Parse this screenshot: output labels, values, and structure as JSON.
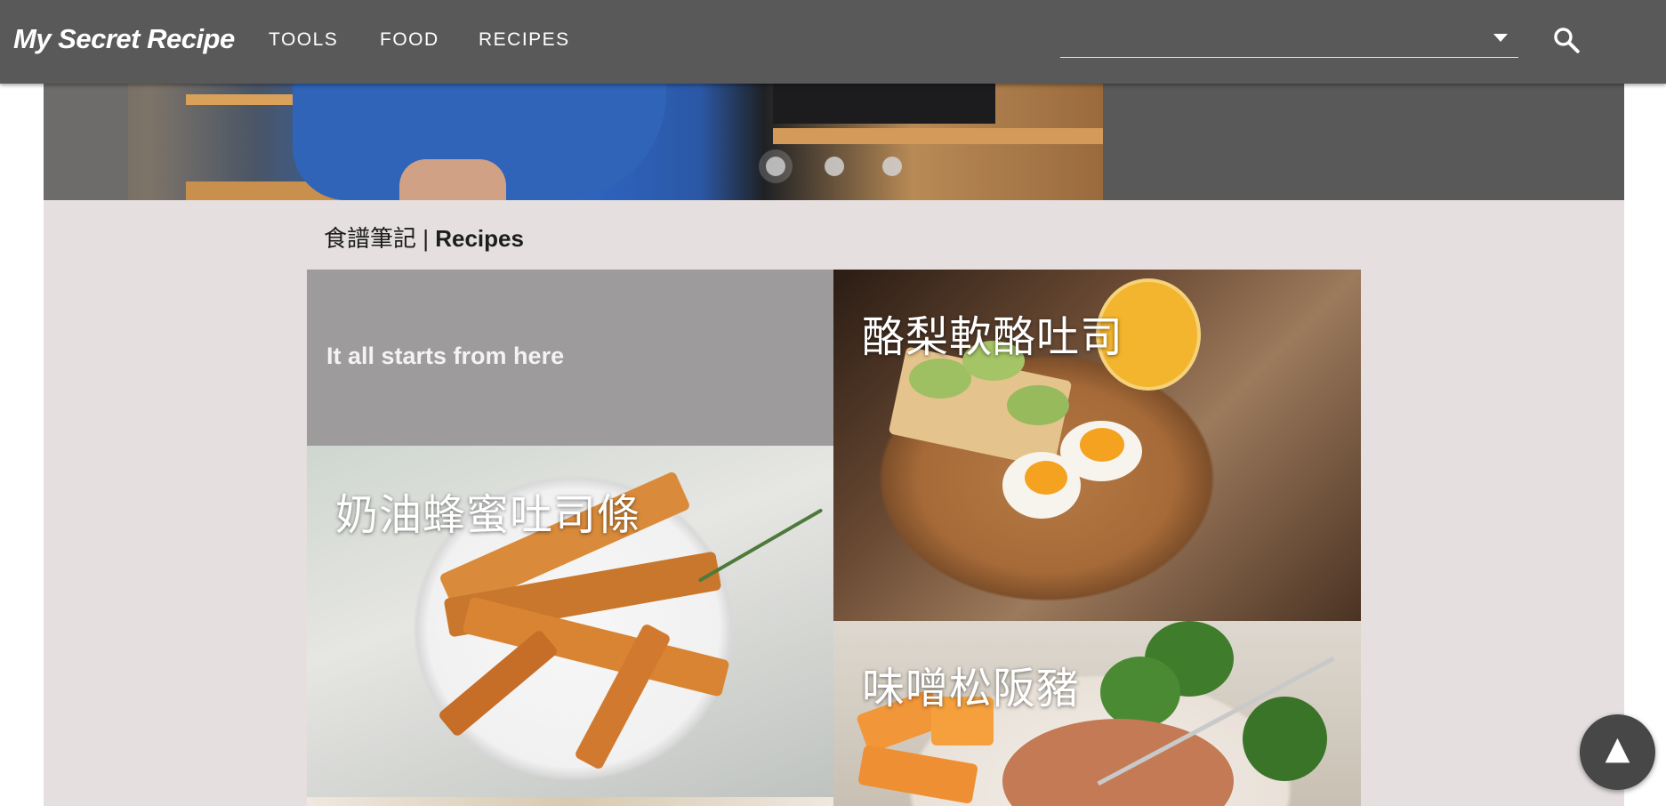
{
  "header": {
    "brand": "My Secret Recipe",
    "nav": [
      {
        "label": "TOOLS"
      },
      {
        "label": "FOOD"
      },
      {
        "label": "RECIPES"
      }
    ],
    "search": {
      "value": "",
      "placeholder": "",
      "icon": "search-icon",
      "dropdown_icon": "caret-down-icon"
    }
  },
  "carousel": {
    "slides": 3,
    "active_index": 0
  },
  "section": {
    "title_zh": "食譜筆記",
    "separator": " | ",
    "title_en": "Recipes"
  },
  "tiles": {
    "intro": "It all starts from here",
    "recipes": [
      {
        "title": "酪梨軟酪吐司"
      },
      {
        "title": "奶油蜂蜜吐司條"
      },
      {
        "title": "味噌松阪豬"
      }
    ]
  },
  "back_to_top": {
    "glyph": "▲",
    "icon": "arrow-up-icon"
  },
  "colors": {
    "appbar": "#595959",
    "content_background": "#e5dfdf",
    "intro_tile": "#9d9b9b",
    "fab": "#474747"
  }
}
